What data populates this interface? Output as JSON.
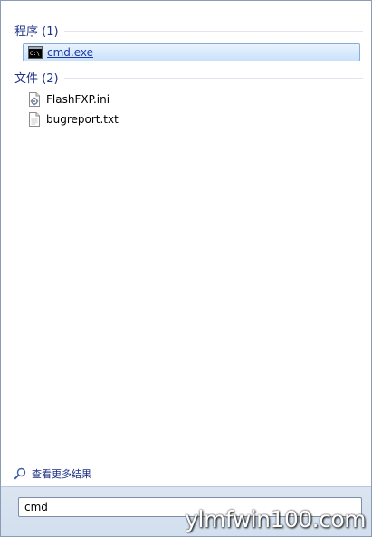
{
  "groups": [
    {
      "title": "程序 (1)",
      "items": [
        {
          "label": "cmd.exe",
          "icon": "console-icon",
          "selected": true
        }
      ]
    },
    {
      "title": "文件 (2)",
      "items": [
        {
          "label": "FlashFXP.ini",
          "icon": "config-file-icon",
          "selected": false
        },
        {
          "label": "bugreport.txt",
          "icon": "text-file-icon",
          "selected": false
        }
      ]
    }
  ],
  "see_more": {
    "label": "查看更多结果",
    "icon": "magnifier-icon"
  },
  "search": {
    "value": "cmd"
  },
  "watermark": {
    "text": "ylmfwin100.com"
  },
  "colors": {
    "group_title": "#1e3287",
    "selection_border": "#84acdd",
    "selection_fill": "#c9e2fb",
    "bottom_bar": "#d2dfee"
  }
}
